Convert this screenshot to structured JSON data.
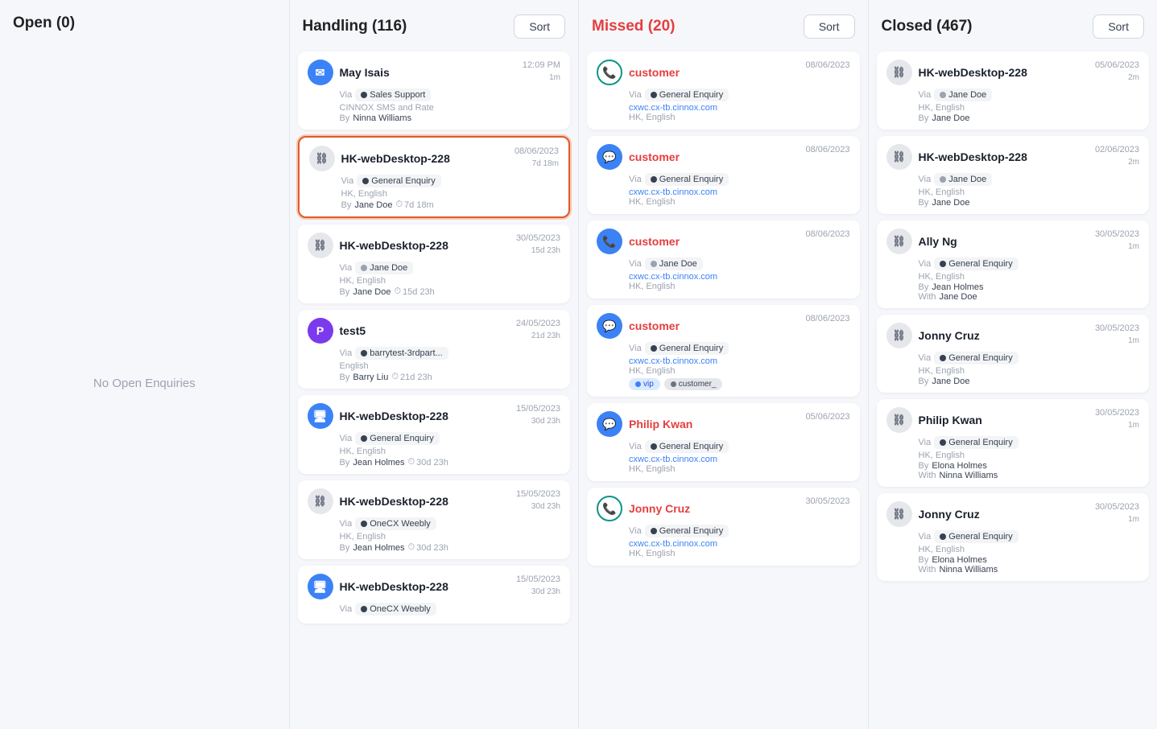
{
  "columns": [
    {
      "id": "open",
      "title": "Open (0)",
      "titleColor": "normal",
      "hasSort": false,
      "empty": true,
      "emptyMsg": "No Open Enquiries",
      "cards": []
    },
    {
      "id": "handling",
      "title": "Handling (116)",
      "titleColor": "normal",
      "hasSort": true,
      "sortLabel": "Sort",
      "empty": false,
      "emptyMsg": "",
      "cards": [
        {
          "id": "h1",
          "name": "May Isais",
          "date": "12:09 PM",
          "subDate": "1m",
          "via": "Sales Support",
          "viaDot": "dark",
          "subText": "CINNOX SMS and Rate",
          "byLabel": "By",
          "byName": "Ninna Williams",
          "link": "",
          "withLabel": "",
          "withName": "",
          "tags": [],
          "timer": "",
          "avatarType": "email",
          "avatarColor": "blue",
          "selected": false
        },
        {
          "id": "h2",
          "name": "HK-webDesktop-228",
          "date": "08/06/2023",
          "subDate": "7d 18m",
          "via": "General Enquiry",
          "viaDot": "dark",
          "subText": "HK, English",
          "byLabel": "By",
          "byName": "Jane Doe",
          "link": "",
          "withLabel": "",
          "withName": "",
          "tags": [],
          "timer": "7d 18m",
          "avatarType": "link",
          "avatarColor": "link",
          "selected": true
        },
        {
          "id": "h3",
          "name": "HK-webDesktop-228",
          "date": "30/05/2023",
          "subDate": "15d 23h",
          "via": "Jane Doe",
          "viaDot": "gray",
          "subText": "HK, English",
          "byLabel": "By",
          "byName": "Jane Doe",
          "link": "",
          "withLabel": "",
          "withName": "",
          "tags": [],
          "timer": "15d 23h",
          "avatarType": "link",
          "avatarColor": "link",
          "selected": false
        },
        {
          "id": "h4",
          "name": "test5",
          "date": "24/05/2023",
          "subDate": "21d 23h",
          "via": "barrytest-3rdpart...",
          "viaDot": "dark",
          "subText": "English",
          "byLabel": "By",
          "byName": "Barry Liu",
          "link": "",
          "withLabel": "",
          "withName": "",
          "tags": [],
          "timer": "21d 23h",
          "avatarType": "purple",
          "avatarColor": "purple",
          "selected": false
        },
        {
          "id": "h5",
          "name": "HK-webDesktop-228",
          "date": "15/05/2023",
          "subDate": "30d 23h",
          "via": "General Enquiry",
          "viaDot": "dark",
          "subText": "HK, English",
          "byLabel": "By",
          "byName": "Jean Holmes",
          "link": "",
          "withLabel": "",
          "withName": "",
          "tags": [],
          "timer": "30d 23h",
          "avatarType": "monitor",
          "avatarColor": "blue",
          "selected": false
        },
        {
          "id": "h6",
          "name": "HK-webDesktop-228",
          "date": "15/05/2023",
          "subDate": "30d 23h",
          "via": "OneCX Weebly",
          "viaDot": "dark",
          "subText": "HK, English",
          "byLabel": "By",
          "byName": "Jean Holmes",
          "link": "",
          "withLabel": "",
          "withName": "",
          "tags": [],
          "timer": "30d 23h",
          "avatarType": "link",
          "avatarColor": "link",
          "selected": false
        },
        {
          "id": "h7",
          "name": "HK-webDesktop-228",
          "date": "15/05/2023",
          "subDate": "30d 23h",
          "via": "OneCX Weebly",
          "viaDot": "dark",
          "subText": "",
          "byLabel": "",
          "byName": "",
          "link": "",
          "withLabel": "",
          "withName": "",
          "tags": [],
          "timer": "",
          "avatarType": "monitor",
          "avatarColor": "blue",
          "selected": false
        }
      ]
    },
    {
      "id": "missed",
      "title": "Missed (20)",
      "titleColor": "missed",
      "hasSort": true,
      "sortLabel": "Sort",
      "empty": false,
      "emptyMsg": "",
      "cards": [
        {
          "id": "m1",
          "name": "customer",
          "date": "08/06/2023",
          "subDate": "",
          "via": "General Enquiry",
          "viaDot": "dark",
          "subText": "HK, English",
          "byLabel": "",
          "byName": "",
          "link": "cxwc.cx-tb.cinnox.com",
          "withLabel": "",
          "withName": "",
          "tags": [],
          "timer": "",
          "avatarType": "phone-green",
          "avatarColor": "teal",
          "selected": false
        },
        {
          "id": "m2",
          "name": "customer",
          "date": "08/06/2023",
          "subDate": "",
          "via": "General Enquiry",
          "viaDot": "dark",
          "subText": "HK, English",
          "byLabel": "",
          "byName": "",
          "link": "cxwc.cx-tb.cinnox.com",
          "withLabel": "",
          "withName": "",
          "tags": [],
          "timer": "",
          "avatarType": "chat",
          "avatarColor": "blue",
          "selected": false
        },
        {
          "id": "m3",
          "name": "customer",
          "date": "08/06/2023",
          "subDate": "",
          "via": "Jane Doe",
          "viaDot": "gray",
          "subText": "HK, English",
          "byLabel": "",
          "byName": "",
          "link": "cxwc.cx-tb.cinnox.com",
          "withLabel": "",
          "withName": "",
          "tags": [],
          "timer": "",
          "avatarType": "phone-blue",
          "avatarColor": "blue",
          "selected": false
        },
        {
          "id": "m4",
          "name": "customer",
          "date": "08/06/2023",
          "subDate": "",
          "via": "General Enquiry",
          "viaDot": "dark",
          "subText": "HK, English",
          "byLabel": "",
          "byName": "",
          "link": "cxwc.cx-tb.cinnox.com",
          "withLabel": "",
          "withName": "",
          "tags": [
            "vip",
            "customer_"
          ],
          "timer": "",
          "avatarType": "chat",
          "avatarColor": "blue",
          "selected": false
        },
        {
          "id": "m5",
          "name": "Philip Kwan",
          "date": "05/06/2023",
          "subDate": "",
          "via": "General Enquiry",
          "viaDot": "dark",
          "subText": "HK, English",
          "byLabel": "",
          "byName": "",
          "link": "cxwc.cx-tb.cinnox.com",
          "withLabel": "",
          "withName": "",
          "tags": [],
          "timer": "",
          "avatarType": "chat",
          "avatarColor": "blue",
          "selected": false
        },
        {
          "id": "m6",
          "name": "Jonny Cruz",
          "date": "30/05/2023",
          "subDate": "",
          "via": "General Enquiry",
          "viaDot": "dark",
          "subText": "HK, English",
          "byLabel": "",
          "byName": "",
          "link": "cxwc.cx-tb.cinnox.com",
          "withLabel": "",
          "withName": "",
          "tags": [],
          "timer": "",
          "avatarType": "phone-green",
          "avatarColor": "teal",
          "selected": false
        }
      ]
    },
    {
      "id": "closed",
      "title": "Closed (467)",
      "titleColor": "normal",
      "hasSort": true,
      "sortLabel": "Sort",
      "empty": false,
      "emptyMsg": "",
      "cards": [
        {
          "id": "c1",
          "name": "HK-webDesktop-228",
          "date": "05/06/2023",
          "subDate": "2m",
          "via": "Jane Doe",
          "viaDot": "gray",
          "subText": "HK, English",
          "byLabel": "By",
          "byName": "Jane Doe",
          "link": "",
          "withLabel": "",
          "withName": "",
          "tags": [],
          "timer": "",
          "avatarType": "link",
          "avatarColor": "link",
          "selected": false
        },
        {
          "id": "c2",
          "name": "HK-webDesktop-228",
          "date": "02/06/2023",
          "subDate": "2m",
          "via": "Jane Doe",
          "viaDot": "gray",
          "subText": "HK, English",
          "byLabel": "By",
          "byName": "Jane Doe",
          "link": "",
          "withLabel": "",
          "withName": "",
          "tags": [],
          "timer": "",
          "avatarType": "link",
          "avatarColor": "link",
          "selected": false
        },
        {
          "id": "c3",
          "name": "Ally Ng",
          "date": "30/05/2023",
          "subDate": "1m",
          "via": "General Enquiry",
          "viaDot": "dark",
          "subText": "HK, English",
          "byLabel": "By",
          "byName": "Jean Holmes",
          "link": "",
          "withLabel": "With",
          "withName": "Jane Doe",
          "tags": [],
          "timer": "",
          "avatarType": "link",
          "avatarColor": "link",
          "selected": false
        },
        {
          "id": "c4",
          "name": "Jonny Cruz",
          "date": "30/05/2023",
          "subDate": "1m",
          "via": "General Enquiry",
          "viaDot": "dark",
          "subText": "HK, English",
          "byLabel": "By",
          "byName": "Jane Doe",
          "link": "",
          "withLabel": "",
          "withName": "",
          "tags": [],
          "timer": "",
          "avatarType": "link",
          "avatarColor": "link",
          "selected": false
        },
        {
          "id": "c5",
          "name": "Philip Kwan",
          "date": "30/05/2023",
          "subDate": "1m",
          "via": "General Enquiry",
          "viaDot": "dark",
          "subText": "HK, English",
          "byLabel": "By",
          "byName": "Elona Holmes",
          "link": "",
          "withLabel": "With",
          "withName": "Ninna Williams",
          "tags": [],
          "timer": "",
          "avatarType": "link",
          "avatarColor": "link",
          "selected": false
        },
        {
          "id": "c6",
          "name": "Jonny Cruz",
          "date": "30/05/2023",
          "subDate": "1m",
          "via": "General Enquiry",
          "viaDot": "dark",
          "subText": "HK, English",
          "byLabel": "By",
          "byName": "Elona Holmes",
          "link": "",
          "withLabel": "With",
          "withName": "Ninna Williams",
          "tags": [],
          "timer": "",
          "avatarType": "link",
          "avatarColor": "link",
          "selected": false
        }
      ]
    }
  ]
}
